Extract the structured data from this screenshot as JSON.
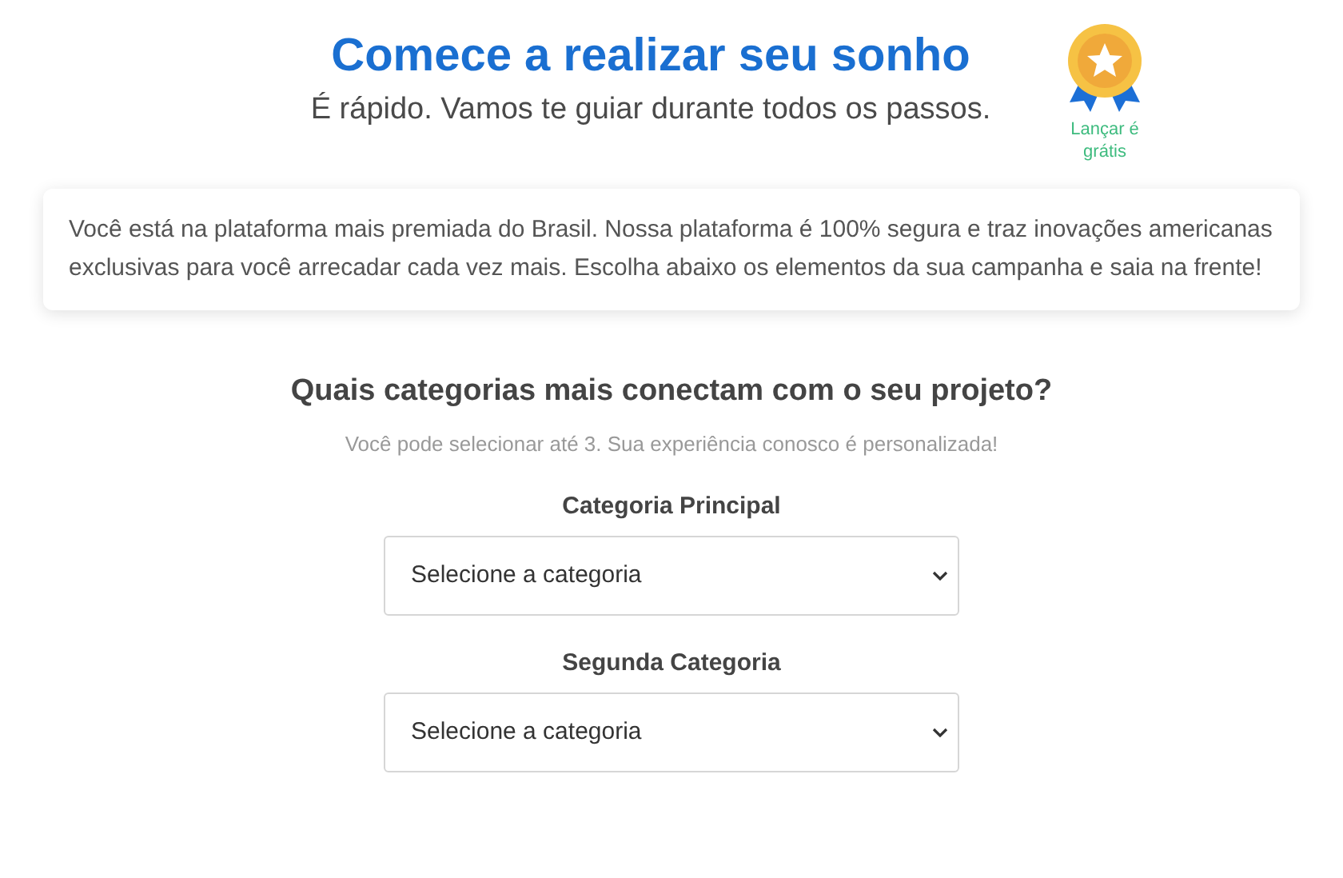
{
  "header": {
    "title": "Comece a realizar seu sonho",
    "subtitle": "É rápido. Vamos te guiar durante todos os passos.",
    "badge_label": "Lançar é grátis"
  },
  "intro": "Você está na plataforma mais premiada do Brasil. Nossa plataforma é 100% segura e traz inovações americanas exclusivas para você arrecadar cada vez mais. Escolha abaixo os elementos da sua campanha e saia na frente!",
  "categories": {
    "heading": "Quais categorias mais conectam com o seu projeto?",
    "hint": "Você pode selecionar até 3. Sua experiência conosco é personalizada!",
    "fields": [
      {
        "label": "Categoria Principal",
        "value": "Selecione a categoria"
      },
      {
        "label": "Segunda Categoria",
        "value": "Selecione a categoria"
      }
    ]
  }
}
